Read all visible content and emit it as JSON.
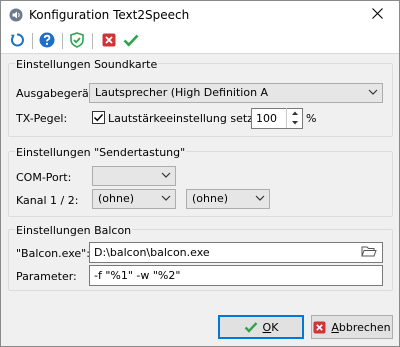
{
  "window": {
    "title": "Konfiguration Text2Speech"
  },
  "toolbar": {
    "icons": [
      "refresh-icon",
      "help-icon",
      "shield-check-icon",
      "cancel-icon",
      "check-icon"
    ]
  },
  "soundcard": {
    "group_title": "Einstellungen Soundkarte",
    "output_device_label": "Ausgabegerät:",
    "output_device_value": "Lautsprecher (High Definition A",
    "tx_level_label": "TX-Pegel:",
    "volume_checkbox_label": "Lautstärkeeinstellung setzen",
    "volume_checkbox_checked": true,
    "level_value": "100",
    "level_unit": "%"
  },
  "transmit": {
    "group_title": "Einstellungen \"Sendertastung\"",
    "com_port_label": "COM-Port:",
    "com_port_value": "",
    "channel_label": "Kanal 1 / 2:",
    "channel1_value": "(ohne)",
    "channel2_value": "(ohne)"
  },
  "balcon": {
    "group_title": "Einstellungen Balcon",
    "exe_label": "\"Balcon.exe\":",
    "exe_value": "D:\\balcon\\balcon.exe",
    "params_label": "Parameter:",
    "params_value": "-f \"%1\" -w \"%2\""
  },
  "buttons": {
    "ok_accel": "O",
    "ok_rest": "K",
    "cancel_accel": "A",
    "cancel_rest": "bbrechen"
  },
  "colors": {
    "accent_blue": "#1e6fc7",
    "success_green": "#2ea44f",
    "cancel_red": "#d13438",
    "default_border": "#0078d7"
  }
}
